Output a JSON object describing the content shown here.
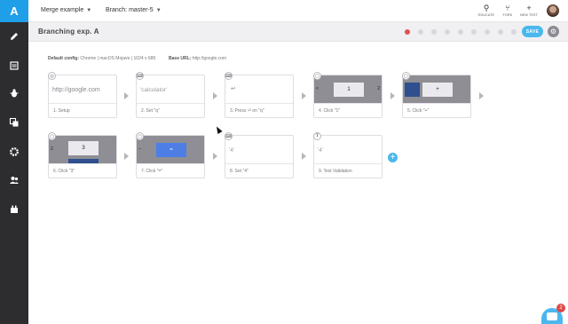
{
  "app": {
    "logo": "A"
  },
  "sidebar": {
    "items": [
      {
        "name": "pencil-icon"
      },
      {
        "name": "list-icon"
      },
      {
        "name": "bug-icon"
      },
      {
        "name": "copy-icon"
      },
      {
        "name": "gear-icon"
      },
      {
        "name": "users-icon"
      },
      {
        "name": "plugin-icon"
      }
    ]
  },
  "topbar": {
    "project": "Merge example",
    "branch": "Branch: master-5",
    "actions": [
      {
        "icon": "map-pin-icon",
        "label": "EDUCATE"
      },
      {
        "icon": "fork-icon",
        "label": "FORK"
      },
      {
        "icon": "plus-icon",
        "label": "NEW TEST"
      }
    ]
  },
  "test": {
    "title": "Branching exp. A",
    "save_label": "SAVE",
    "config_label": "Default config:",
    "config_value": "Chrome | macOS Mojave | 1024 x 680",
    "base_url_label": "Base URL:",
    "base_url_value": "http://google.com"
  },
  "steps": [
    {
      "index": 1,
      "caption": "1. Setup",
      "badge": "🌐",
      "preview": "http://google.com"
    },
    {
      "index": 2,
      "caption": "2. Set \"q\"",
      "badge": "⌨",
      "preview": "'calculator'"
    },
    {
      "index": 3,
      "caption": "3. Press ⏎ on \"q\"",
      "badge": "⌨",
      "preview": "↵"
    },
    {
      "index": 4,
      "caption": "4. Click \"1\"",
      "badge": "🖱",
      "key": "1",
      "left": "<",
      "right": "2"
    },
    {
      "index": 5,
      "caption": "5. Click \"+\"",
      "badge": "🖱",
      "key": "+"
    },
    {
      "index": 6,
      "caption": "6. Click \"3\"",
      "badge": "🖱",
      "key": "3",
      "left": "2"
    },
    {
      "index": 7,
      "caption": "7. Click \"=\"",
      "badge": "🖱",
      "key": "=",
      "left": "–"
    },
    {
      "index": 8,
      "caption": "8. Set \"4\"",
      "badge": "⌨",
      "preview": "'4'"
    },
    {
      "index": 9,
      "caption": "9. Text Validation",
      "badge": "T",
      "preview": "'4'"
    }
  ],
  "chat": {
    "count": "2"
  },
  "colors": {
    "accent": "#4ab8ee",
    "sidebar": "#2d2d2f",
    "logo": "#1f9fe8",
    "record": "#e05252"
  }
}
